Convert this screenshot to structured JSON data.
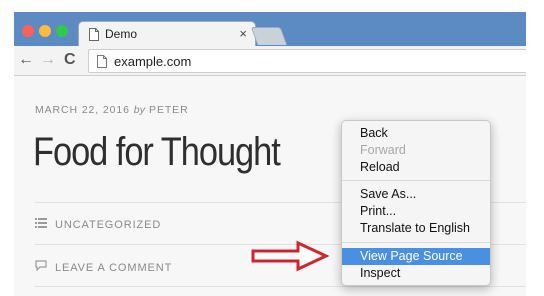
{
  "tab": {
    "title": "Demo",
    "close": "×"
  },
  "toolbar": {
    "back": "←",
    "forward": "→",
    "reload": "C",
    "url": "example.com"
  },
  "post": {
    "date": "MARCH 22, 2016",
    "by": "by",
    "author": "PETER",
    "title": "Food for Thought",
    "category": "UNCATEGORIZED",
    "comment_link": "LEAVE A COMMENT"
  },
  "context_menu": {
    "back": "Back",
    "forward": "Forward",
    "reload": "Reload",
    "save_as": "Save As...",
    "print": "Print...",
    "translate": "Translate to English",
    "view_source": "View Page Source",
    "inspect": "Inspect"
  },
  "icons": {
    "page": "page-icon",
    "list": "list-icon",
    "comment": "comment-icon",
    "arrow": "red-arrow-icon"
  },
  "colors": {
    "titlebar": "#5c8ac2",
    "highlight": "#4a90e2",
    "arrow": "#d0252b"
  }
}
